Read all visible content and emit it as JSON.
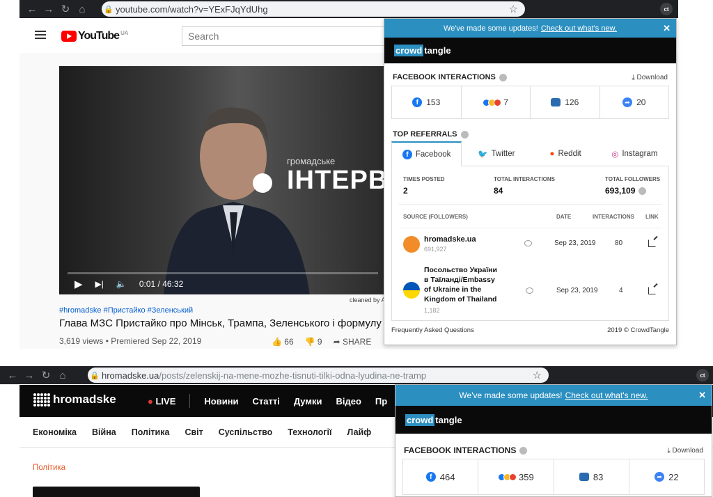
{
  "browser1": {
    "url_host": "youtube.com",
    "url_path": "/watch?v=YExFJqYdUhg",
    "ext_badge": "ct"
  },
  "browser2": {
    "url_host": "hromadske.ua",
    "url_path": "/posts/zelenskij-na-mene-mozhe-tisnuti-tilki-odna-lyudina-ne-tramp",
    "ext_badge": "ct"
  },
  "youtube": {
    "logo": "YouTube",
    "region": "UA",
    "search_placeholder": "Search",
    "video_overlay_small": "громадське",
    "video_overlay_big": "ІНТЕРВ",
    "time": "0:01 / 46:32",
    "cleaned": "cleaned by A",
    "tags": "#hromadske #Пристайко #Зеленський",
    "title": "Глава МЗС Пристайко про Мінськ, Трампа, Зеленського і формулу",
    "views": "3,619 views • Premiered Sep 22, 2019",
    "likes": "66",
    "dislikes": "9",
    "share": "SHARE"
  },
  "ct1": {
    "banner_text": "We've made some updates!",
    "banner_link": "Check out what's new.",
    "logo_a": "crowd",
    "logo_b": "tangle",
    "fb_title": "FACEBOOK INTERACTIONS",
    "download": "Download",
    "likes": "153",
    "reactions": "7",
    "comments": "126",
    "shares": "20",
    "ref_title": "TOP REFERRALS",
    "tabs": [
      "Facebook",
      "Twitter",
      "Reddit",
      "Instagram"
    ],
    "times_posted_label": "TIMES POSTED",
    "times_posted": "2",
    "total_interactions_label": "TOTAL INTERACTIONS",
    "total_interactions": "84",
    "total_followers_label": "TOTAL FOLLOWERS",
    "total_followers": "693,109",
    "col_source": "SOURCE (FOLLOWERS)",
    "col_date": "DATE",
    "col_interactions": "INTERACTIONS",
    "col_link": "LINK",
    "rows": [
      {
        "name": "hromadske.ua",
        "followers": "691,927",
        "date": "Sep 23, 2019",
        "interactions": "80"
      },
      {
        "name_l1": "Посольство України",
        "name_l2": "в Таїланді/Embassy",
        "name_l3": "of Ukraine in the",
        "name_l4": "Kingdom of Thailand",
        "followers": "1,182",
        "date": "Sep 23, 2019",
        "interactions": "4"
      }
    ],
    "footer_left": "Frequently Asked Questions",
    "footer_right": "2019 © CrowdTangle"
  },
  "hromadske": {
    "logo": "hromadske",
    "live": "LIVE",
    "nav": [
      "Новини",
      "Статті",
      "Думки",
      "Відео",
      "Пр"
    ],
    "subnav": [
      "Економіка",
      "Війна",
      "Політика",
      "Світ",
      "Суспільство",
      "Технології",
      "Лайф"
    ],
    "category": "Політика"
  },
  "ct2": {
    "banner_text": "We've made some updates!",
    "banner_link": "Check out what's new.",
    "logo_a": "crowd",
    "logo_b": "tangle",
    "fb_title": "FACEBOOK INTERACTIONS",
    "download": "Download",
    "likes": "464",
    "reactions": "359",
    "comments": "83",
    "shares": "22"
  },
  "colors": {
    "ct_blue": "#2b8fc0",
    "yt_red": "#ff0000",
    "fb_blue": "#1877f2",
    "hromadske_orange": "#e85d2a"
  }
}
